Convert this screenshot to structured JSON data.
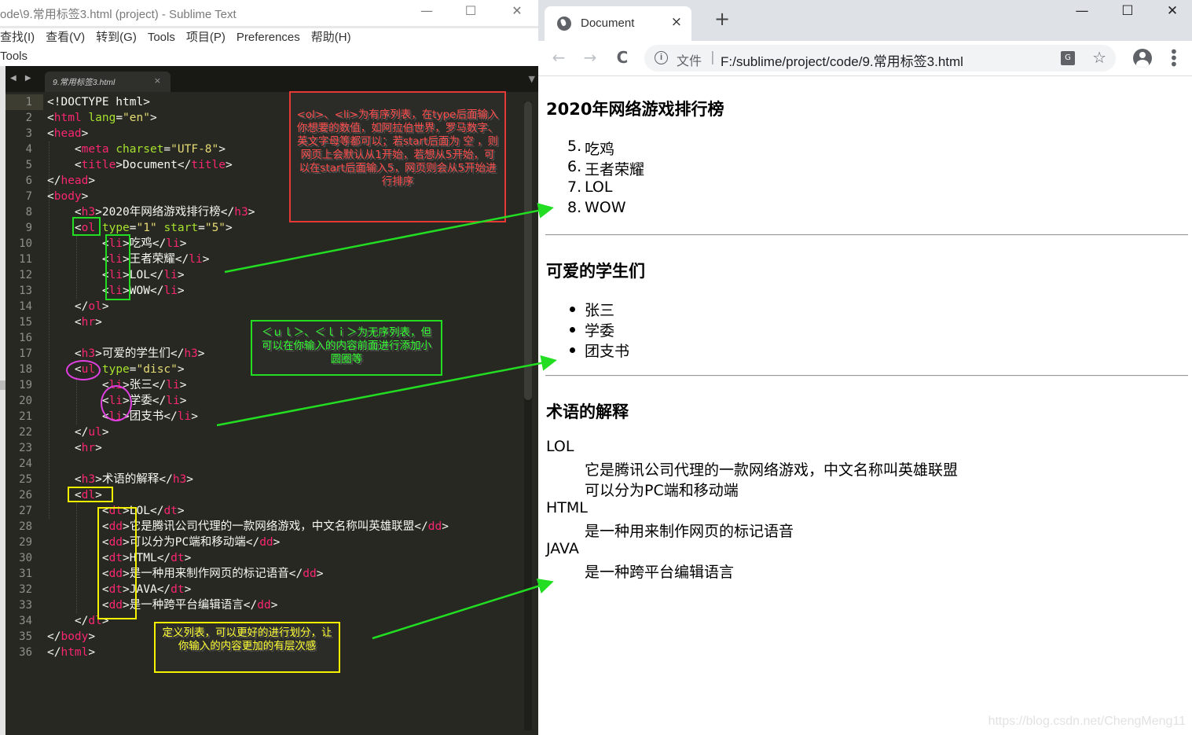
{
  "sublime": {
    "title": "ode\\9.常用标签3.html (project) - Sublime Text",
    "window_controls": {
      "minimize": "—",
      "maximize": "☐",
      "close": "✕"
    },
    "menu": [
      "查找(I)",
      "查看(V)",
      "转到(G)",
      "Tools",
      "项目(P)",
      "Preferences",
      "帮助(H)"
    ],
    "tools_label": "Tools",
    "tab": {
      "label": "9.常用标签3.html",
      "close": "×"
    },
    "nav_arrows": "◀ ▶",
    "overflow_icon": "▼",
    "code_lines": [
      [
        [
          "p",
          "<!DOCTYPE html>"
        ]
      ],
      [
        [
          "p",
          "<"
        ],
        [
          "t",
          "html"
        ],
        [
          "p",
          " "
        ],
        [
          "a",
          "lang"
        ],
        [
          "p",
          "="
        ],
        [
          "s",
          "\"en\""
        ],
        [
          "p",
          ">"
        ]
      ],
      [
        [
          "p",
          "<"
        ],
        [
          "t",
          "head"
        ],
        [
          "p",
          ">"
        ]
      ],
      [
        [
          "p",
          "    <"
        ],
        [
          "t",
          "meta"
        ],
        [
          "p",
          " "
        ],
        [
          "a",
          "charset"
        ],
        [
          "p",
          "="
        ],
        [
          "s",
          "\"UTF-8\""
        ],
        [
          "p",
          ">"
        ]
      ],
      [
        [
          "p",
          "    <"
        ],
        [
          "t",
          "title"
        ],
        [
          "p",
          ">Document</"
        ],
        [
          "t",
          "title"
        ],
        [
          "p",
          ">"
        ]
      ],
      [
        [
          "p",
          "</"
        ],
        [
          "t",
          "head"
        ],
        [
          "p",
          ">"
        ]
      ],
      [
        [
          "p",
          "<"
        ],
        [
          "t",
          "body"
        ],
        [
          "p",
          ">"
        ]
      ],
      [
        [
          "p",
          "    <"
        ],
        [
          "t",
          "h3"
        ],
        [
          "p",
          ">2020年网络游戏排行榜</"
        ],
        [
          "t",
          "h3"
        ],
        [
          "p",
          ">"
        ]
      ],
      [
        [
          "p",
          "    <"
        ],
        [
          "t",
          "ol"
        ],
        [
          "p",
          " "
        ],
        [
          "a",
          "type"
        ],
        [
          "p",
          "="
        ],
        [
          "s",
          "\"1\""
        ],
        [
          "p",
          " "
        ],
        [
          "a",
          "start"
        ],
        [
          "p",
          "="
        ],
        [
          "s",
          "\"5\""
        ],
        [
          "p",
          ">"
        ]
      ],
      [
        [
          "p",
          "        <"
        ],
        [
          "t",
          "li"
        ],
        [
          "p",
          ">吃鸡</"
        ],
        [
          "t",
          "li"
        ],
        [
          "p",
          ">"
        ]
      ],
      [
        [
          "p",
          "        <"
        ],
        [
          "t",
          "li"
        ],
        [
          "p",
          ">王者荣耀</"
        ],
        [
          "t",
          "li"
        ],
        [
          "p",
          ">"
        ]
      ],
      [
        [
          "p",
          "        <"
        ],
        [
          "t",
          "li"
        ],
        [
          "p",
          ">LOL</"
        ],
        [
          "t",
          "li"
        ],
        [
          "p",
          ">"
        ]
      ],
      [
        [
          "p",
          "        <"
        ],
        [
          "t",
          "li"
        ],
        [
          "p",
          ">WOW</"
        ],
        [
          "t",
          "li"
        ],
        [
          "p",
          ">"
        ]
      ],
      [
        [
          "p",
          "    </"
        ],
        [
          "t",
          "ol"
        ],
        [
          "p",
          ">"
        ]
      ],
      [
        [
          "p",
          "    <"
        ],
        [
          "t",
          "hr"
        ],
        [
          "p",
          ">"
        ]
      ],
      [],
      [
        [
          "p",
          "    <"
        ],
        [
          "t",
          "h3"
        ],
        [
          "p",
          ">可爱的学生们</"
        ],
        [
          "t",
          "h3"
        ],
        [
          "p",
          ">"
        ]
      ],
      [
        [
          "p",
          "    <"
        ],
        [
          "t",
          "ul"
        ],
        [
          "p",
          " "
        ],
        [
          "a",
          "type"
        ],
        [
          "p",
          "="
        ],
        [
          "s",
          "\"disc\""
        ],
        [
          "p",
          ">"
        ]
      ],
      [
        [
          "p",
          "        <"
        ],
        [
          "t",
          "li"
        ],
        [
          "p",
          ">张三</"
        ],
        [
          "t",
          "li"
        ],
        [
          "p",
          ">"
        ]
      ],
      [
        [
          "p",
          "        <"
        ],
        [
          "t",
          "li"
        ],
        [
          "p",
          ">学委</"
        ],
        [
          "t",
          "li"
        ],
        [
          "p",
          ">"
        ]
      ],
      [
        [
          "p",
          "        <"
        ],
        [
          "t",
          "li"
        ],
        [
          "p",
          ">团支书</"
        ],
        [
          "t",
          "li"
        ],
        [
          "p",
          ">"
        ]
      ],
      [
        [
          "p",
          "    </"
        ],
        [
          "t",
          "ul"
        ],
        [
          "p",
          ">"
        ]
      ],
      [
        [
          "p",
          "    <"
        ],
        [
          "t",
          "hr"
        ],
        [
          "p",
          ">"
        ]
      ],
      [],
      [
        [
          "p",
          "    <"
        ],
        [
          "t",
          "h3"
        ],
        [
          "p",
          ">术语的解释</"
        ],
        [
          "t",
          "h3"
        ],
        [
          "p",
          ">"
        ]
      ],
      [
        [
          "p",
          "    <"
        ],
        [
          "t",
          "dl"
        ],
        [
          "p",
          ">"
        ]
      ],
      [
        [
          "p",
          "        <"
        ],
        [
          "t",
          "dt"
        ],
        [
          "p",
          ">LOL</"
        ],
        [
          "t",
          "dt"
        ],
        [
          "p",
          ">"
        ]
      ],
      [
        [
          "p",
          "        <"
        ],
        [
          "t",
          "dd"
        ],
        [
          "p",
          ">它是腾讯公司代理的一款网络游戏，中文名称叫英雄联盟</"
        ],
        [
          "t",
          "dd"
        ],
        [
          "p",
          ">"
        ]
      ],
      [
        [
          "p",
          "        <"
        ],
        [
          "t",
          "dd"
        ],
        [
          "p",
          ">可以分为PC端和移动端</"
        ],
        [
          "t",
          "dd"
        ],
        [
          "p",
          ">"
        ]
      ],
      [
        [
          "p",
          "        <"
        ],
        [
          "t",
          "dt"
        ],
        [
          "p",
          ">HTML</"
        ],
        [
          "t",
          "dt"
        ],
        [
          "p",
          ">"
        ]
      ],
      [
        [
          "p",
          "        <"
        ],
        [
          "t",
          "dd"
        ],
        [
          "p",
          ">是一种用来制作网页的标记语音</"
        ],
        [
          "t",
          "dd"
        ],
        [
          "p",
          ">"
        ]
      ],
      [
        [
          "p",
          "        <"
        ],
        [
          "t",
          "dt"
        ],
        [
          "p",
          ">JAVA</"
        ],
        [
          "t",
          "dt"
        ],
        [
          "p",
          ">"
        ]
      ],
      [
        [
          "p",
          "        <"
        ],
        [
          "t",
          "dd"
        ],
        [
          "p",
          ">是一种跨平台编辑语言</"
        ],
        [
          "t",
          "dd"
        ],
        [
          "p",
          ">"
        ]
      ],
      [
        [
          "p",
          "    </"
        ],
        [
          "t",
          "dl"
        ],
        [
          "p",
          ">"
        ]
      ],
      [
        [
          "p",
          "</"
        ],
        [
          "t",
          "body"
        ],
        [
          "p",
          ">"
        ]
      ],
      [
        [
          "p",
          "</"
        ],
        [
          "t",
          "html"
        ],
        [
          "p",
          ">"
        ]
      ]
    ],
    "annotations": {
      "ol": "<ol>、<li>为有序列表，在type后面输入你想要的数值，如阿拉伯世界，罗马数字、英文字母等都可以；若start后面为 空 ，则网页上会默认从1开始，若想从5开始，可以在start后面输入5，网页则会从5开始进行排序",
      "ul": "＜ｕｌ＞、＜ｌｉ＞为无序列表，但可以在你输入的内容前面进行添加小圆圈等",
      "dl": "定义列表，可以更好的进行划分，让你输入的内容更加的有层次感"
    },
    "colors": {
      "ol_note": "#ff4d4d",
      "ul_note": "#33ff33",
      "dl_note": "#ffff33",
      "arrow": "#22dd22"
    }
  },
  "browser": {
    "tab_title": "Document",
    "tab_close": "×",
    "new_tab": "+",
    "window_controls": {
      "minimize": "—",
      "maximize": "☐",
      "close": "✕"
    },
    "nav": {
      "back": "←",
      "forward": "→",
      "reload": "C"
    },
    "omnibox": {
      "info_icon": "i",
      "scheme_label": "文件",
      "separator": "|",
      "url": "F:/sublime/project/code/9.常用标签3.html",
      "translate_icon": "G",
      "bookmark_icon": "☆"
    },
    "menu_icon": "⋮"
  },
  "page": {
    "ordered": {
      "heading": "2020年网络游戏排行榜",
      "start": 5,
      "items": [
        "吃鸡",
        "王者荣耀",
        "LOL",
        "WOW"
      ],
      "markers": [
        "5.",
        "6.",
        "7.",
        "8."
      ]
    },
    "unordered": {
      "heading": "可爱的学生们",
      "items": [
        "张三",
        "学委",
        "团支书"
      ]
    },
    "definitions": {
      "heading": "术语的解释",
      "entries": [
        {
          "term": "LOL",
          "descs": [
            "它是腾讯公司代理的一款网络游戏，中文名称叫英雄联盟",
            "可以分为PC端和移动端"
          ]
        },
        {
          "term": "HTML",
          "descs": [
            "是一种用来制作网页的标记语音"
          ]
        },
        {
          "term": "JAVA",
          "descs": [
            "是一种跨平台编辑语言"
          ]
        }
      ]
    },
    "watermark": "https://blog.csdn.net/ChengMeng11"
  }
}
